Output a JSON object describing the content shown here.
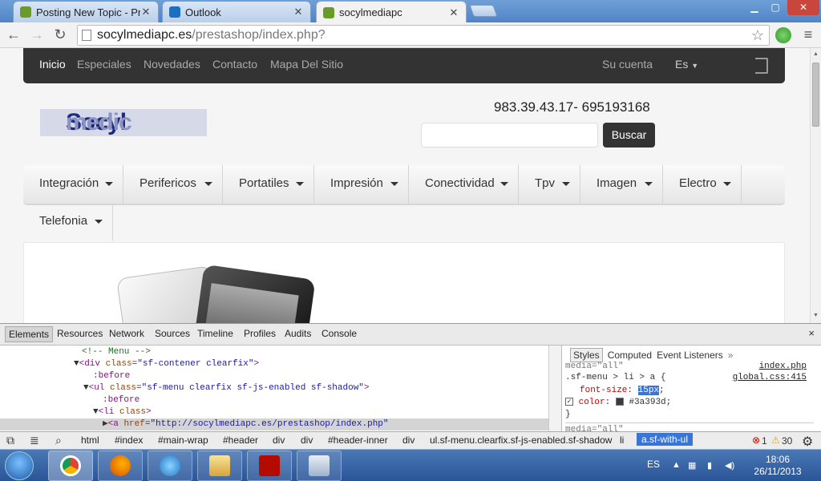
{
  "tabs": [
    {
      "title": "Posting New Topic - Prest",
      "favicon_color": "#6a9a2a"
    },
    {
      "title": "Outlook",
      "favicon_color": "#1a6fc2"
    },
    {
      "title": "socylmediapc",
      "favicon_color": "#6a9a2a"
    }
  ],
  "tab_close": "✕",
  "window": {
    "minimize": "▁",
    "maximize": "▢",
    "close": "✕"
  },
  "nav": {
    "back": "←",
    "forward": "→",
    "reload": "↻",
    "menu": "≡",
    "star": "☆"
  },
  "omnibox": {
    "host": "socylmediapc.es",
    "path": "/prestashop/index.php?"
  },
  "site": {
    "nav_links": [
      "Inicio",
      "Especiales",
      "Novedades",
      "Contacto",
      "Mapa Del Sitio"
    ],
    "account": "Su cuenta",
    "language": "Es",
    "logo_part1": "Socyl",
    "logo_part2": "medic",
    "phone": "983.39.43.17- 695193168",
    "search_button": "Buscar",
    "menu": [
      "Integración",
      "Perifericos",
      "Portatiles",
      "Impresión",
      "Conectividad",
      "Tpv",
      "Imagen",
      "Electro"
    ],
    "menu_row2": "Telefonia"
  },
  "devtools": {
    "tabs": [
      "Elements",
      "Resources",
      "Network",
      "Sources",
      "Timeline",
      "Profiles",
      "Audits",
      "Console"
    ],
    "close": "×",
    "elements": {
      "comment": "<!-- Menu -->",
      "div_open": "<div",
      "div_attr": "class",
      "div_val": "\"sf-contener clearfix\"",
      "before1": ":before",
      "ul_open": "<ul",
      "ul_attr": "class",
      "ul_val": "\"sf-menu clearfix sf-js-enabled sf-shadow\"",
      "before2": ":before",
      "li_open": "<li",
      "li_attr": "class",
      "a_open": "<a",
      "a_attr": "href",
      "a_val": "\"http://socylmediapc.es/prestashop/index.php\""
    },
    "styles_tabs": [
      "Styles",
      "Computed",
      "Event Listeners",
      "»"
    ],
    "styles": {
      "media_top": "media=\"all\"",
      "file1": "index.php",
      "selector": ".sf-menu > li > a {",
      "file2": "global.css:415",
      "prop1": "font-size",
      "val1": "15px",
      "prop2": "color",
      "val2": "#3a393d",
      "close": "}",
      "media_bottom": "media=\"all\""
    },
    "breadcrumbs": [
      "html",
      "#index",
      "#main-wrap",
      "#header",
      "div",
      "div",
      "#header-inner",
      "div",
      "ul.sf-menu.clearfix.sf-js-enabled.sf-shadow",
      "li",
      "a.sf-with-ul"
    ],
    "errors": "1",
    "warnings": "30"
  },
  "taskbar": {
    "language": "ES",
    "time": "18:06",
    "date": "26/11/2013"
  }
}
